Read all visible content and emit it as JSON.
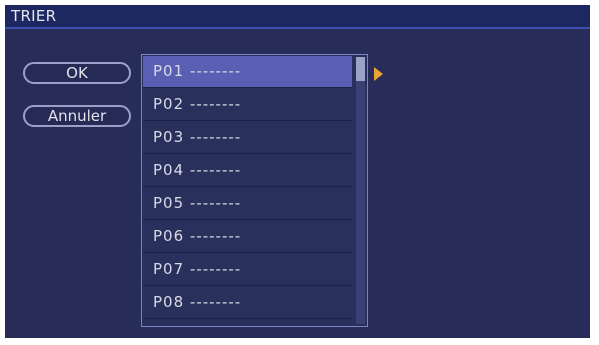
{
  "window": {
    "title": "TRIER"
  },
  "buttons": {
    "ok": "OK",
    "cancel": "Annuler"
  },
  "list": {
    "selected_index": 0,
    "items": [
      {
        "label": "P01 --------"
      },
      {
        "label": "P02 --------"
      },
      {
        "label": "P03 --------"
      },
      {
        "label": "P04 --------"
      },
      {
        "label": "P05 --------"
      },
      {
        "label": "P06 --------"
      },
      {
        "label": "P07 --------"
      },
      {
        "label": "P08 --------"
      }
    ]
  },
  "icons": {
    "expand": "triangle-right-icon"
  },
  "colors": {
    "background": "#272c58",
    "titlebar": "#1e2860",
    "selection": "#5a5fb4",
    "arrow": "#e8a430"
  }
}
